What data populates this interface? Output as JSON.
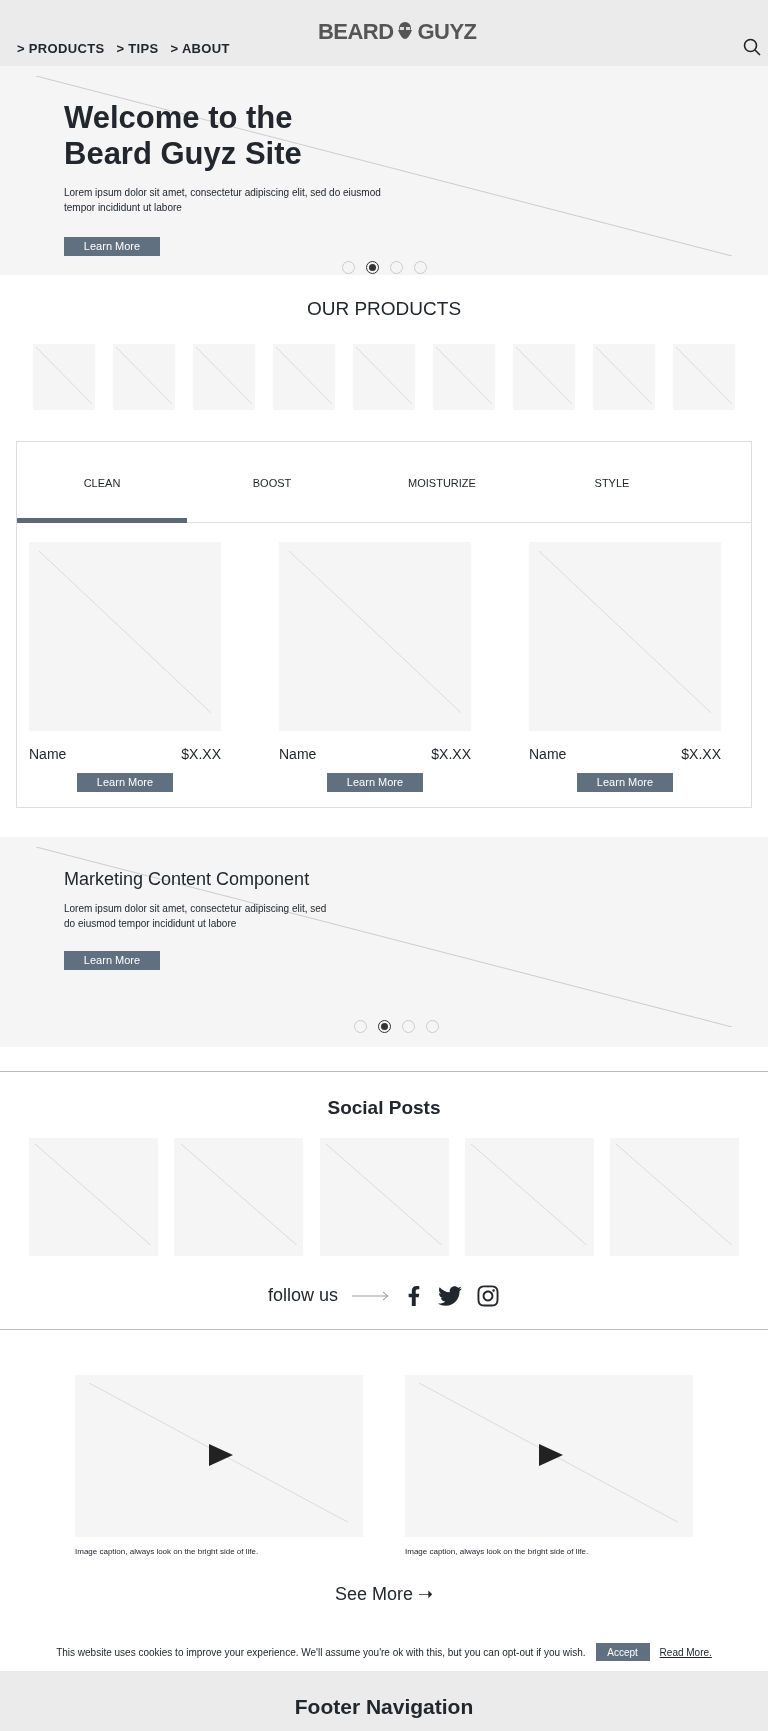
{
  "header": {
    "logo": {
      "left": "BEARD",
      "right": "GUYZ"
    },
    "nav": [
      {
        "arrow": ">",
        "label": "PRODUCTS"
      },
      {
        "arrow": ">",
        "label": "TIPS"
      },
      {
        "arrow": ">",
        "label": "ABOUT"
      }
    ]
  },
  "hero": {
    "title": "Welcome to the Beard Guyz Site",
    "text": "Lorem ipsum dolor sit amet, consectetur adipiscing elit, sed do eiusmod tempor incididunt ut labore",
    "button": "Learn More",
    "dots": [
      {
        "selected": false
      },
      {
        "selected": true
      },
      {
        "selected": false
      },
      {
        "selected": false
      }
    ]
  },
  "products": {
    "title": "OUR PRODUCTS"
  },
  "tabs": [
    {
      "label": "CLEAN",
      "selected": true
    },
    {
      "label": "BOOST",
      "selected": false
    },
    {
      "label": "MOISTURIZE",
      "selected": false
    },
    {
      "label": "STYLE",
      "selected": false
    }
  ],
  "cards": [
    {
      "name": "Name",
      "price": "$X.XX",
      "button": "Learn More"
    },
    {
      "name": "Name",
      "price": "$X.XX",
      "button": "Learn More"
    },
    {
      "name": "Name",
      "price": "$X.XX",
      "button": "Learn More"
    }
  ],
  "marketing": {
    "title": "Marketing Content Component",
    "text": "Lorem ipsum dolor sit amet, consectetur adipiscing elit, sed do eiusmod tempor incididunt ut labore",
    "button": "Learn More",
    "dots": [
      {
        "selected": false
      },
      {
        "selected": true
      },
      {
        "selected": false
      },
      {
        "selected": false
      }
    ]
  },
  "social": {
    "title": "Social Posts",
    "follow": "follow us"
  },
  "videos": [
    {
      "caption": "Image caption, always look on the bright side of life."
    },
    {
      "caption": "Image caption, always look on the bright side of life."
    }
  ],
  "see_more": "See More ➝",
  "cookie": {
    "text": "This website uses cookies to improve your experience. We'll assume you're ok with this, but you can opt-out if you wish.",
    "accept": "Accept",
    "read_more": "Read More."
  },
  "footer": {
    "title": "Footer Navigation"
  }
}
